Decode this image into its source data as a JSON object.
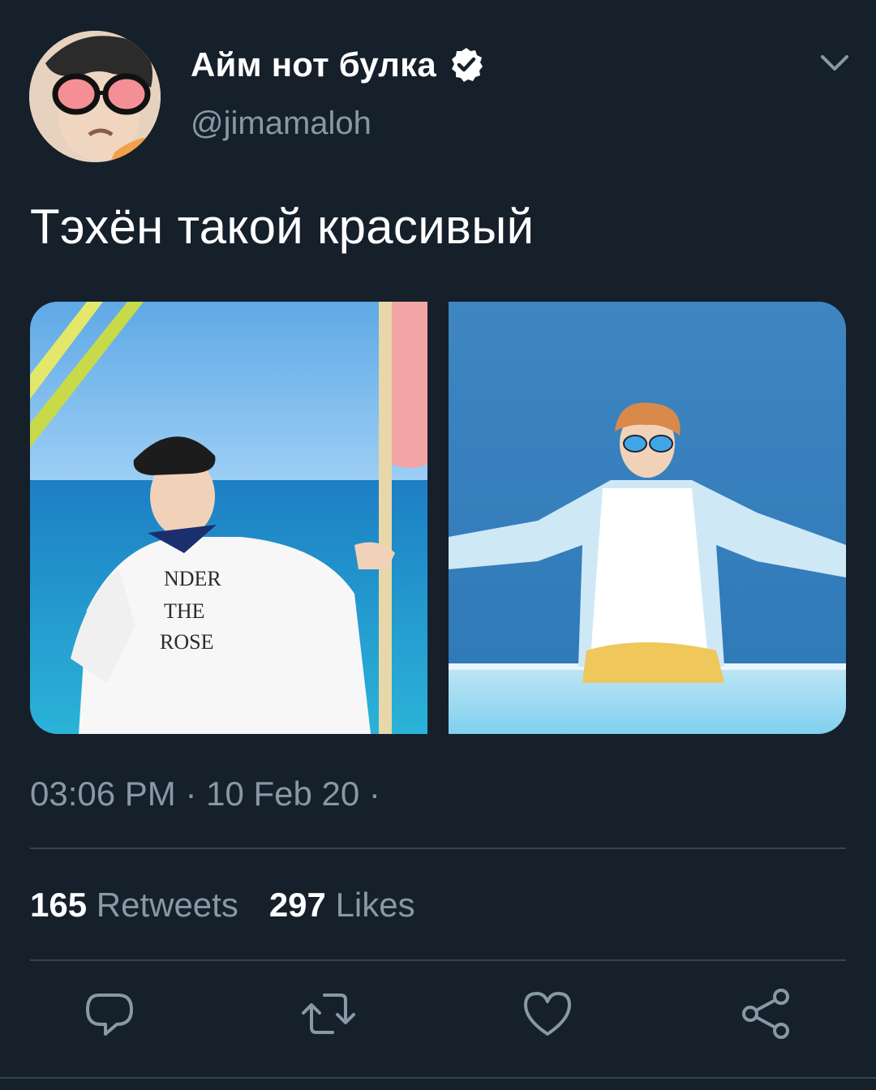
{
  "author": {
    "display_name": "Айм нот булка",
    "handle": "@jimamaloh",
    "verified": true
  },
  "tweet": {
    "text": "Тэхён такой красивый",
    "timestamp": "03:06 PM · 10 Feb 20 ·",
    "images": [
      {
        "shirt_text_line1": "NDER",
        "shirt_text_line2": "THE",
        "shirt_text_line3": "ROSE"
      },
      {}
    ]
  },
  "stats": {
    "retweets_count": "165",
    "retweets_label": "Retweets",
    "likes_count": "297",
    "likes_label": "Likes"
  },
  "actions": {
    "reply_icon": "reply-icon",
    "retweet_icon": "retweet-icon",
    "like_icon": "heart-icon",
    "share_icon": "share-icon"
  },
  "colors": {
    "background": "#15202b",
    "secondary_text": "#8899a6",
    "divider": "#38444d",
    "verified_badge": "#ffffff"
  }
}
